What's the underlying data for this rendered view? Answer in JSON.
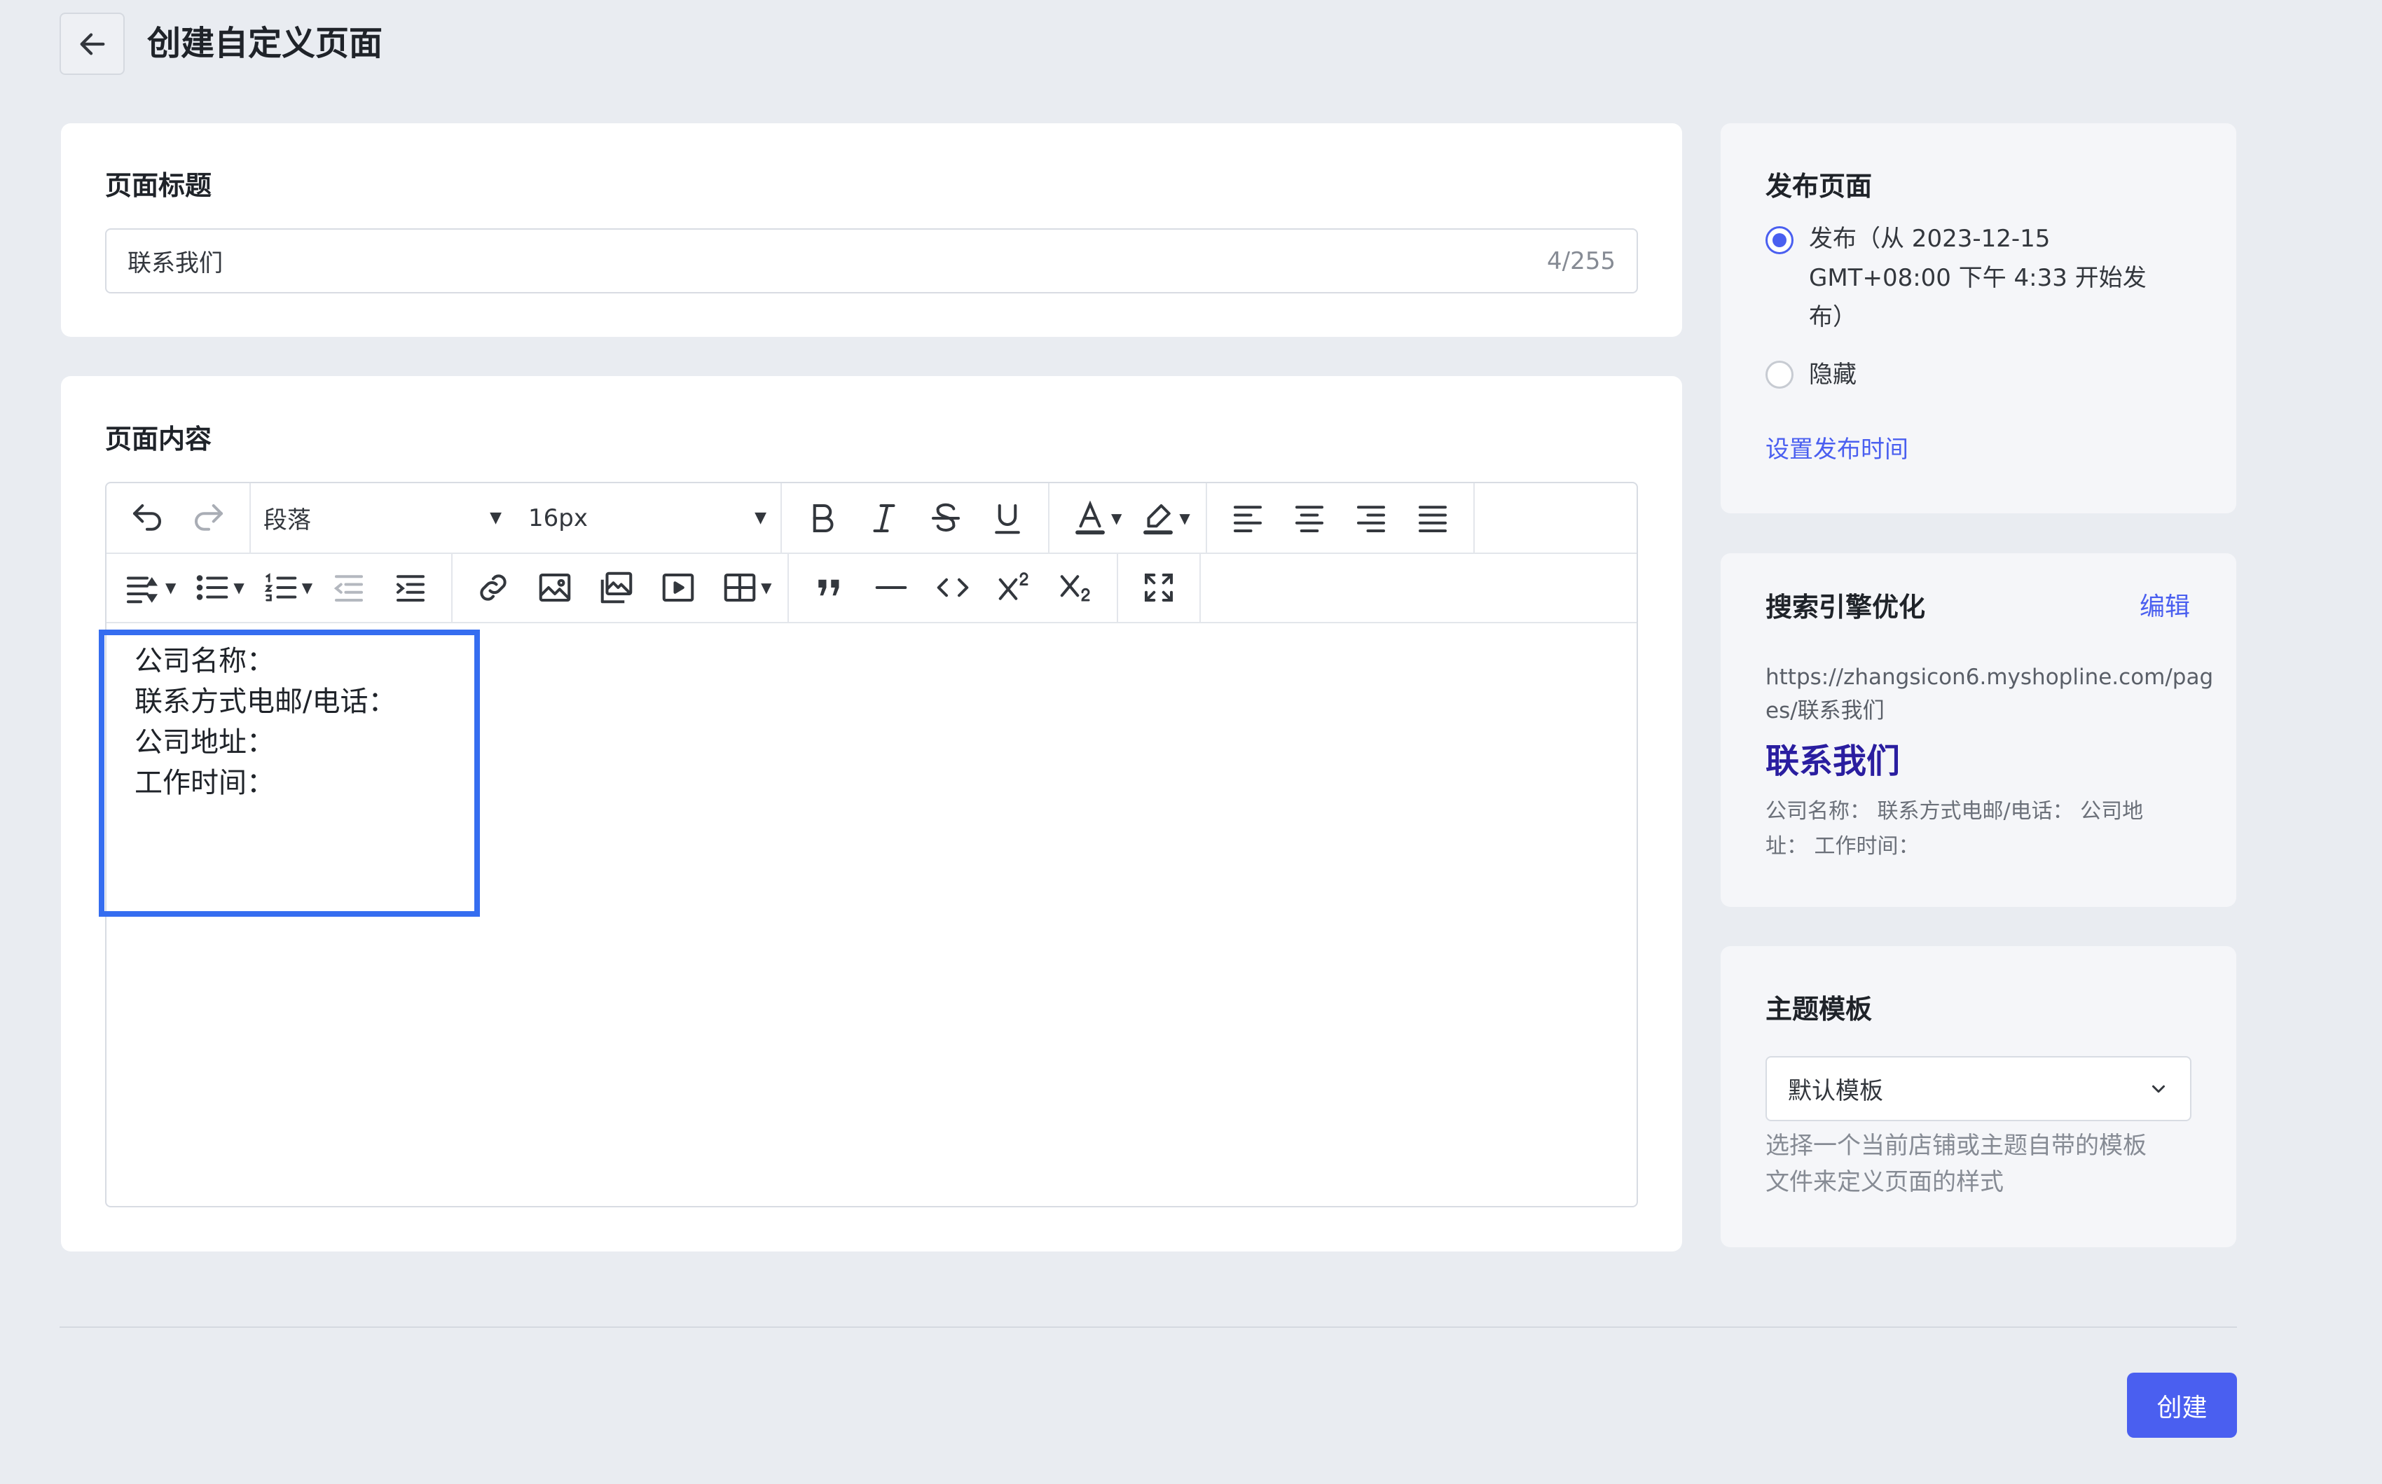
{
  "header": {
    "title": "创建自定义页面"
  },
  "page_title_section": {
    "label": "页面标题",
    "value": "联系我们",
    "counter": "4/255"
  },
  "content_section": {
    "label": "页面内容",
    "toolbar": {
      "paragraph_style": "段落",
      "font_size": "16px"
    },
    "body_lines": [
      "公司名称：",
      "联系方式电邮/电话：",
      "公司地址：",
      "工作时间："
    ]
  },
  "publish": {
    "heading": "发布页面",
    "option_publish_lines": [
      "发布（从 2023-12-15",
      "GMT+08:00 下午 4:33 开始发",
      "布）"
    ],
    "option_hide": "隐藏",
    "set_time_link": "设置发布时间"
  },
  "seo": {
    "heading": "搜索引擎优化",
    "edit_link": "编辑",
    "url_lines": [
      "https://zhangsicon6.myshopline.com/pag",
      "es/联系我们"
    ],
    "preview_title": "联系我们",
    "preview_desc_lines": [
      "公司名称：  联系方式电邮/电话：  公司地",
      "址：  工作时间："
    ]
  },
  "theme": {
    "heading": "主题模板",
    "selected": "默认模板",
    "help_lines": [
      "选择一个当前店铺或主题自带的模板",
      "文件来定义页面的样式"
    ]
  },
  "footer": {
    "create_label": "创建"
  },
  "colors": {
    "accent": "#4a5ff0",
    "highlight_box": "#356df0",
    "background": "#e9ecf1",
    "seo_title": "#2a1ea0"
  }
}
